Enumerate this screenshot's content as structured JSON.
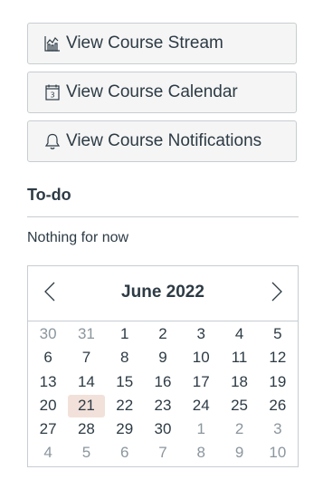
{
  "buttons": {
    "stream": {
      "label": "View Course Stream",
      "icon": "stream-chart-icon"
    },
    "calendar": {
      "label": "View Course Calendar",
      "icon": "calendar-icon"
    },
    "notifications": {
      "label": "View Course Notifications",
      "icon": "bell-icon"
    }
  },
  "todo": {
    "title": "To-do",
    "empty_text": "Nothing for now"
  },
  "calendar": {
    "month_label": "June 2022",
    "prev_icon": "chevron-left-icon",
    "next_icon": "chevron-right-icon",
    "today": "21",
    "weeks": [
      [
        {
          "d": "30",
          "muted": true
        },
        {
          "d": "31",
          "muted": true
        },
        {
          "d": "1"
        },
        {
          "d": "2"
        },
        {
          "d": "3"
        },
        {
          "d": "4"
        },
        {
          "d": "5"
        }
      ],
      [
        {
          "d": "6"
        },
        {
          "d": "7"
        },
        {
          "d": "8"
        },
        {
          "d": "9"
        },
        {
          "d": "10"
        },
        {
          "d": "11"
        },
        {
          "d": "12"
        }
      ],
      [
        {
          "d": "13"
        },
        {
          "d": "14"
        },
        {
          "d": "15"
        },
        {
          "d": "16"
        },
        {
          "d": "17"
        },
        {
          "d": "18"
        },
        {
          "d": "19"
        }
      ],
      [
        {
          "d": "20"
        },
        {
          "d": "21",
          "today": true
        },
        {
          "d": "22"
        },
        {
          "d": "23"
        },
        {
          "d": "24"
        },
        {
          "d": "25"
        },
        {
          "d": "26"
        }
      ],
      [
        {
          "d": "27"
        },
        {
          "d": "28"
        },
        {
          "d": "29"
        },
        {
          "d": "30"
        },
        {
          "d": "1",
          "muted": true
        },
        {
          "d": "2",
          "muted": true
        },
        {
          "d": "3",
          "muted": true
        }
      ],
      [
        {
          "d": "4",
          "muted": true
        },
        {
          "d": "5",
          "muted": true
        },
        {
          "d": "6",
          "muted": true
        },
        {
          "d": "7",
          "muted": true
        },
        {
          "d": "8",
          "muted": true
        },
        {
          "d": "9",
          "muted": true
        },
        {
          "d": "10",
          "muted": true
        }
      ]
    ]
  },
  "colors": {
    "text": "#2d3b45",
    "muted_text": "#8b969e",
    "border": "#c7cdd1",
    "button_bg": "#f5f5f5",
    "today_bg": "#f2e1da"
  }
}
